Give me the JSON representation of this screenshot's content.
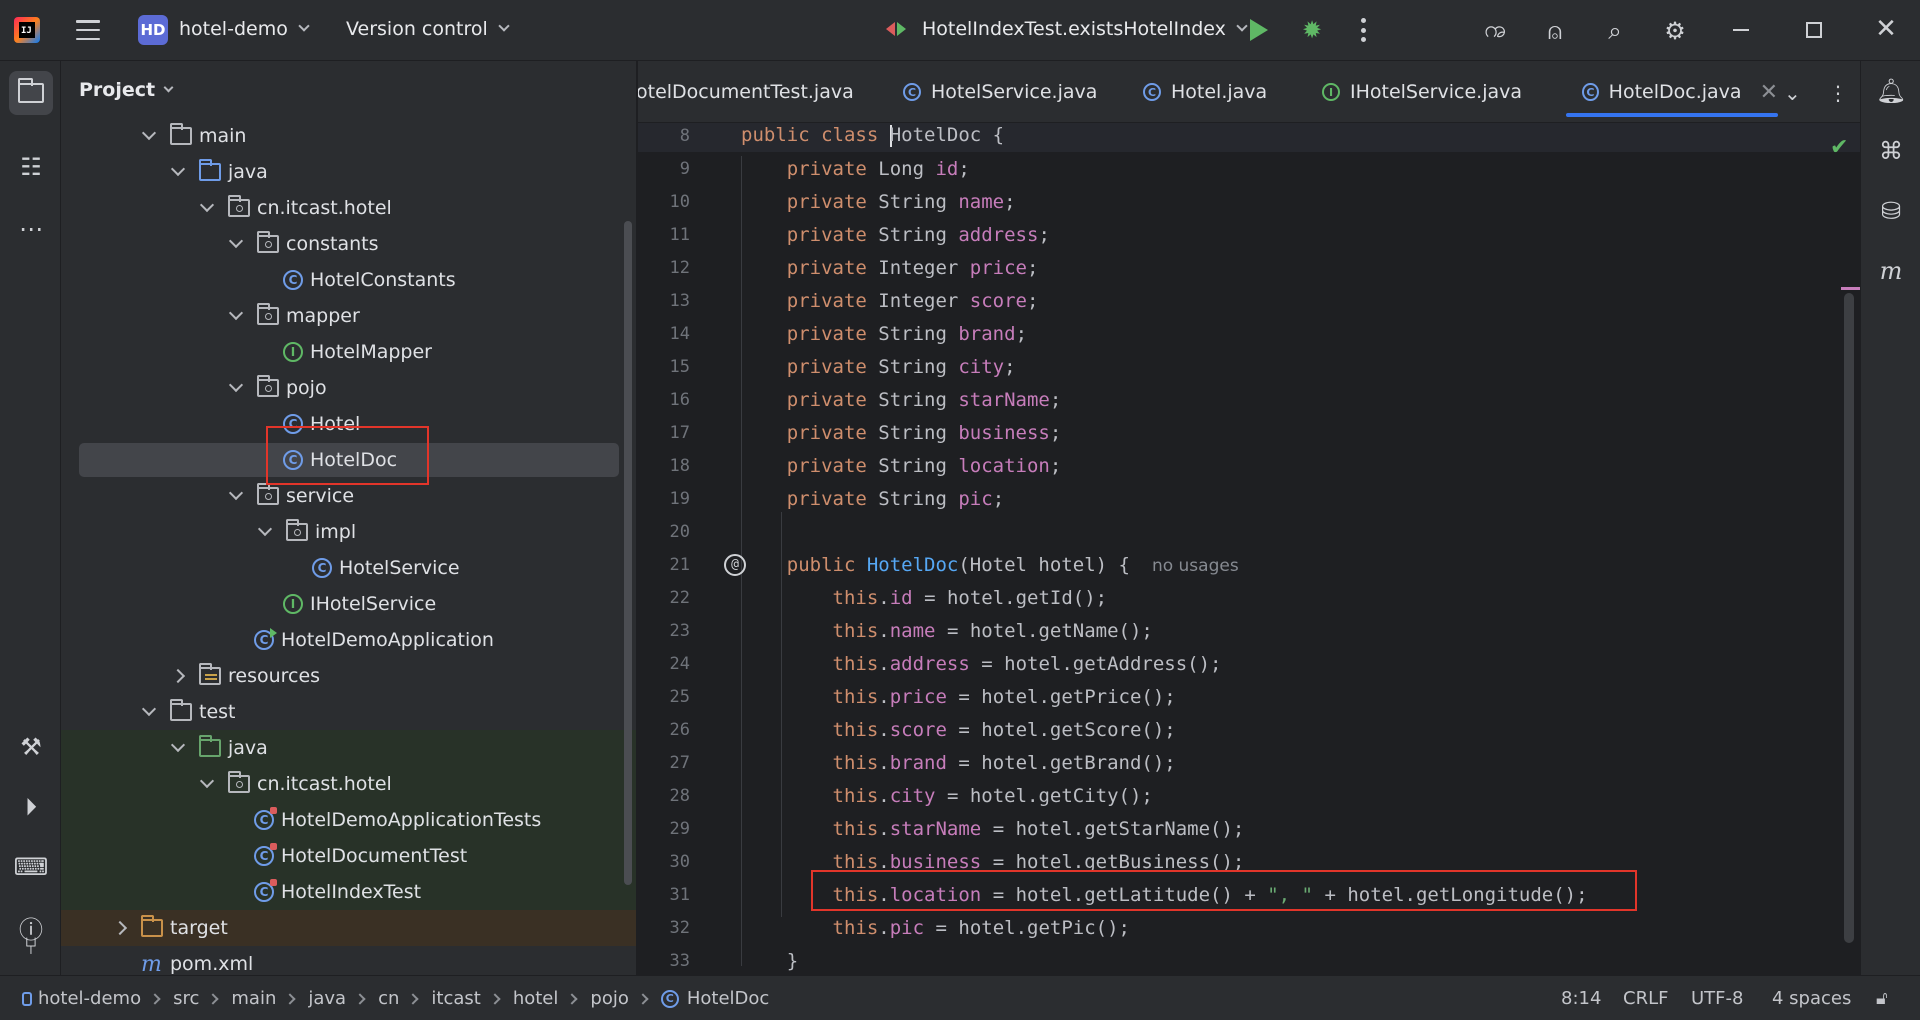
{
  "titlebar": {
    "project_badge": "HD",
    "project_name": "hotel-demo",
    "vcs_label": "Version control",
    "run_config": "HotelIndexTest.existsHotelIndex"
  },
  "project_panel": {
    "title": "Project",
    "tree": [
      {
        "label": "main",
        "icon": "folder-icon"
      },
      {
        "label": "java",
        "icon": "source-folder-icon"
      },
      {
        "label": "cn.itcast.hotel",
        "icon": "package-icon"
      },
      {
        "label": "constants",
        "icon": "package-icon"
      },
      {
        "label": "HotelConstants",
        "icon": "class-icon"
      },
      {
        "label": "mapper",
        "icon": "package-icon"
      },
      {
        "label": "HotelMapper",
        "icon": "interface-icon"
      },
      {
        "label": "pojo",
        "icon": "package-icon"
      },
      {
        "label": "Hotel",
        "icon": "class-icon"
      },
      {
        "label": "HotelDoc",
        "icon": "class-icon"
      },
      {
        "label": "service",
        "icon": "package-icon"
      },
      {
        "label": "impl",
        "icon": "package-icon"
      },
      {
        "label": "HotelService",
        "icon": "class-icon"
      },
      {
        "label": "IHotelService",
        "icon": "interface-icon"
      },
      {
        "label": "HotelDemoApplication",
        "icon": "spring-boot-class-icon"
      },
      {
        "label": "resources",
        "icon": "resources-folder-icon"
      },
      {
        "label": "test",
        "icon": "folder-icon"
      },
      {
        "label": "java",
        "icon": "test-source-folder-icon"
      },
      {
        "label": "cn.itcast.hotel",
        "icon": "package-icon"
      },
      {
        "label": "HotelDemoApplicationTests",
        "icon": "test-class-icon"
      },
      {
        "label": "HotelDocumentTest",
        "icon": "test-class-icon"
      },
      {
        "label": "HotelIndexTest",
        "icon": "test-class-icon"
      },
      {
        "label": "target",
        "icon": "excluded-folder-icon"
      },
      {
        "label": "pom.xml",
        "icon": "maven-icon"
      }
    ]
  },
  "tabs": [
    {
      "label": "otelDocumentTest.java"
    },
    {
      "label": "HotelService.java"
    },
    {
      "label": "Hotel.java"
    },
    {
      "label": "IHotelService.java"
    },
    {
      "label": "HotelDoc.java"
    }
  ],
  "editor": {
    "line_numbers": [
      "8",
      "9",
      "10",
      "11",
      "12",
      "13",
      "14",
      "15",
      "16",
      "17",
      "18",
      "19",
      "20",
      "21",
      "22",
      "23",
      "24",
      "25",
      "26",
      "27",
      "28",
      "29",
      "30",
      "31",
      "32",
      "33"
    ],
    "usage_hint": "no usages",
    "fields": [
      "id",
      "name",
      "address",
      "price",
      "score",
      "brand",
      "city",
      "starName",
      "business",
      "location",
      "pic"
    ],
    "field_types": [
      "Long",
      "String",
      "String",
      "Integer",
      "Integer",
      "String",
      "String",
      "String",
      "String",
      "String",
      "String"
    ],
    "getters": [
      "getId",
      "getName",
      "getAddress",
      "getPrice",
      "getScore",
      "getBrand",
      "getCity",
      "getStarName",
      "getBusiness"
    ],
    "pic_getter": "getPic",
    "class_name": "HotelDoc",
    "param_type": "Hotel",
    "param_name": "hotel",
    "location_expr": {
      "lat": "getLatitude",
      "sep": "\", \"",
      "lon": "getLongitude"
    }
  },
  "statusbar": {
    "breadcrumb": [
      "hotel-demo",
      "src",
      "main",
      "java",
      "cn",
      "itcast",
      "hotel",
      "pojo",
      "HotelDoc"
    ],
    "position": "8:14",
    "line_sep": "CRLF",
    "encoding": "UTF-8",
    "indent": "4 spaces"
  },
  "colors": {
    "accent": "#3574f0",
    "highlight_box": "#e2352a",
    "keyword": "#cf8e6d",
    "field": "#c77dbb",
    "class_decl": "#56a8f5",
    "string": "#6aab73"
  }
}
